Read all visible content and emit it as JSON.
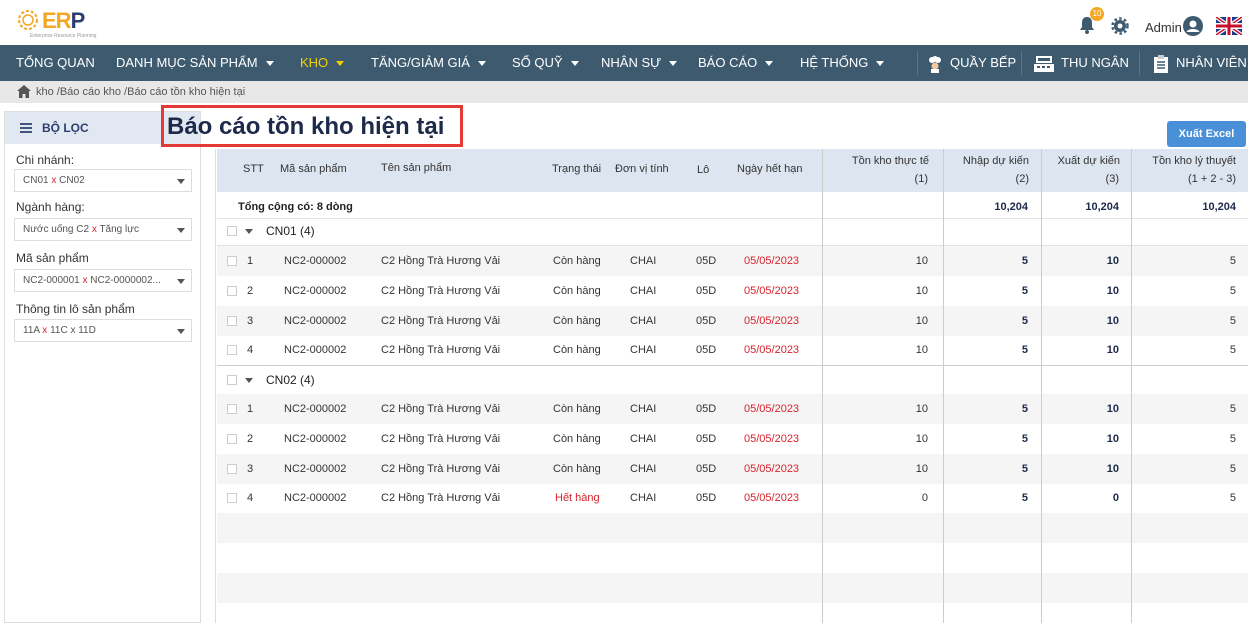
{
  "app": {
    "logo_text_1": "ER",
    "logo_text_2": "P",
    "logo_sub": "Enterprise Resource Planning",
    "notification_count": "10",
    "user": "Admin"
  },
  "colors": {
    "nav_bg": "#3d5a6e",
    "active": "#f5d000",
    "accent": "#4a90d9",
    "danger": "#d9232d"
  },
  "nav": {
    "items": [
      {
        "label": "TỔNG QUAN"
      },
      {
        "label": "DANH MỤC SẢN PHẨM"
      },
      {
        "label": "KHO"
      },
      {
        "label": "TĂNG/GIẢM GIÁ"
      },
      {
        "label": "SỔ QUỸ"
      },
      {
        "label": "NHÂN SỰ"
      },
      {
        "label": "BÁO CÁO"
      },
      {
        "label": "HỆ THỐNG"
      }
    ],
    "right": [
      {
        "label": "QUẦY BẾP",
        "icon": "chef-icon"
      },
      {
        "label": "THU NGÂN",
        "icon": "cash-register-icon"
      },
      {
        "label": "NHÂN VIÊN",
        "icon": "clipboard-icon"
      }
    ]
  },
  "breadcrumb": "kho /Báo cáo kho /Báo cáo tồn kho hiện tại",
  "sidebar": {
    "title": "BỘ LỌC",
    "filters": [
      {
        "label": "Chi nhánh:",
        "values": [
          "CN01",
          "CN02"
        ]
      },
      {
        "label": "Ngành hàng:",
        "values": [
          "Nước uống C2",
          "Tăng lực"
        ]
      },
      {
        "label": "Mã sản phẩm",
        "values": [
          "NC2-000001",
          "NC2-0000002..."
        ]
      },
      {
        "label": "Thông tin lô sản phẩm",
        "values": [
          "11A",
          "11C",
          "11D"
        ]
      }
    ]
  },
  "page": {
    "title": "Báo cáo tồn kho hiện tại",
    "export_label": "Xuất Excel"
  },
  "table": {
    "headers": {
      "stt": "STT",
      "code": "Mã sản phẩm",
      "name": "Tên sản phẩm",
      "status": "Trạng thái",
      "unit": "Đơn vị tính",
      "lot": "Lô",
      "expiry": "Ngày hết hạn",
      "stock": "Tồn kho thực tế",
      "stock_sub": "(1)",
      "import": "Nhập dự kiến",
      "import_sub": "(2)",
      "export": "Xuất dự kiến",
      "export_sub": "(3)",
      "theory": "Tồn kho lý thuyết",
      "theory_sub": "(1 + 2 - 3)"
    },
    "total": {
      "label": "Tổng cộng có: 8 dòng",
      "import": "10,204",
      "export": "10,204",
      "theory": "10,204"
    },
    "groups": [
      {
        "name": "CN01 (4)",
        "rows": [
          {
            "stt": "1",
            "code": "NC2-000002",
            "name": "C2 Hồng Trà Hương Vải",
            "status": "Còn hàng",
            "unit": "CHAI",
            "lot": "05D",
            "expiry": "05/05/2023",
            "stock": "10",
            "import": "5",
            "export": "10",
            "theory": "5"
          },
          {
            "stt": "2",
            "code": "NC2-000002",
            "name": "C2 Hồng Trà Hương Vải",
            "status": "Còn hàng",
            "unit": "CHAI",
            "lot": "05D",
            "expiry": "05/05/2023",
            "stock": "10",
            "import": "5",
            "export": "10",
            "theory": "5"
          },
          {
            "stt": "3",
            "code": "NC2-000002",
            "name": "C2 Hồng Trà Hương Vải",
            "status": "Còn hàng",
            "unit": "CHAI",
            "lot": "05D",
            "expiry": "05/05/2023",
            "stock": "10",
            "import": "5",
            "export": "10",
            "theory": "5"
          },
          {
            "stt": "4",
            "code": "NC2-000002",
            "name": "C2 Hồng Trà Hương Vải",
            "status": "Còn hàng",
            "unit": "CHAI",
            "lot": "05D",
            "expiry": "05/05/2023",
            "stock": "10",
            "import": "5",
            "export": "10",
            "theory": "5"
          }
        ]
      },
      {
        "name": "CN02 (4)",
        "rows": [
          {
            "stt": "1",
            "code": "NC2-000002",
            "name": "C2 Hồng Trà Hương Vải",
            "status": "Còn hàng",
            "unit": "CHAI",
            "lot": "05D",
            "expiry": "05/05/2023",
            "stock": "10",
            "import": "5",
            "export": "10",
            "theory": "5"
          },
          {
            "stt": "2",
            "code": "NC2-000002",
            "name": "C2 Hồng Trà Hương Vải",
            "status": "Còn hàng",
            "unit": "CHAI",
            "lot": "05D",
            "expiry": "05/05/2023",
            "stock": "10",
            "import": "5",
            "export": "10",
            "theory": "5"
          },
          {
            "stt": "3",
            "code": "NC2-000002",
            "name": "C2 Hồng Trà Hương Vải",
            "status": "Còn hàng",
            "unit": "CHAI",
            "lot": "05D",
            "expiry": "05/05/2023",
            "stock": "10",
            "import": "5",
            "export": "10",
            "theory": "5"
          },
          {
            "stt": "4",
            "code": "NC2-000002",
            "name": "C2 Hồng Trà Hương Vải",
            "status": "Hết hàng",
            "unit": "CHAI",
            "lot": "05D",
            "expiry": "05/05/2023",
            "stock": "0",
            "import": "5",
            "export": "0",
            "theory": "5"
          }
        ]
      }
    ]
  }
}
